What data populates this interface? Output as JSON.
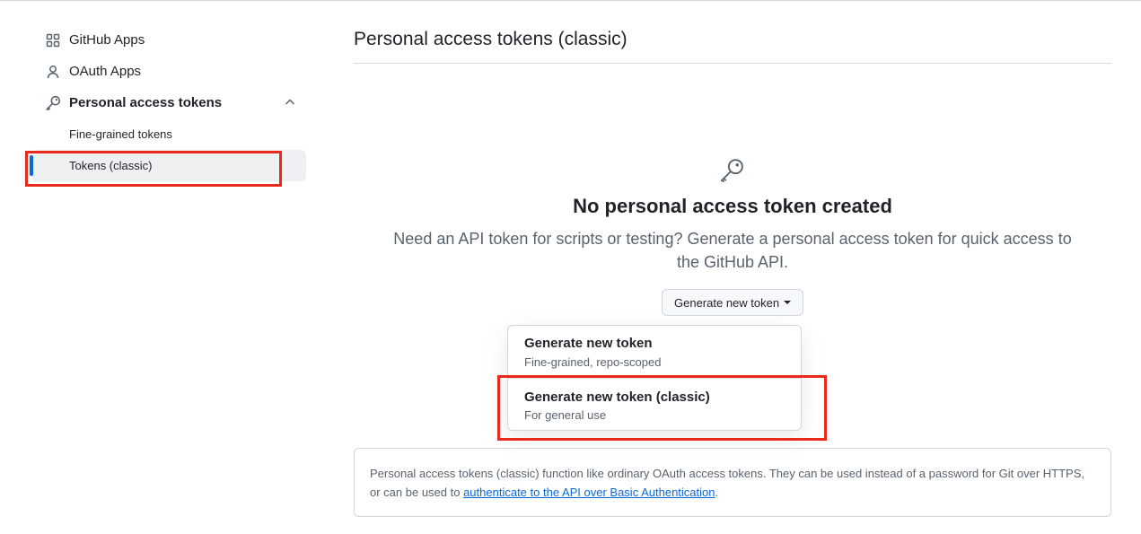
{
  "sidebar": {
    "items": [
      {
        "label": "GitHub Apps",
        "icon": "apps-icon"
      },
      {
        "label": "OAuth Apps",
        "icon": "person-icon"
      },
      {
        "label": "Personal access tokens",
        "icon": "key-icon",
        "expanded": true
      }
    ],
    "sub_items": [
      {
        "label": "Fine-grained tokens",
        "active": false
      },
      {
        "label": "Tokens (classic)",
        "active": true
      }
    ]
  },
  "main": {
    "title": "Personal access tokens (classic)",
    "blankslate": {
      "icon": "key-icon",
      "heading": "No personal access token created",
      "description_line1": "Need an API token for scripts or testing? Generate a personal access token for quick access to",
      "description_line2": "the GitHub API."
    },
    "generate_button": {
      "label": "Generate new token"
    },
    "dropdown": [
      {
        "title": "Generate new token",
        "subtitle": "Fine-grained, repo-scoped"
      },
      {
        "title": "Generate new token (classic)",
        "subtitle": "For general use"
      }
    ],
    "info": {
      "text": "Personal access tokens (classic) function like ordinary OAuth access tokens. They can be used instead of a password for Git over HTTPS, or can be used to ",
      "link": "authenticate to the API over Basic Authentication",
      "suffix": "."
    }
  },
  "colors": {
    "accent": "#0969da",
    "highlight_box": "#e8291c",
    "muted_text": "#59636e"
  }
}
